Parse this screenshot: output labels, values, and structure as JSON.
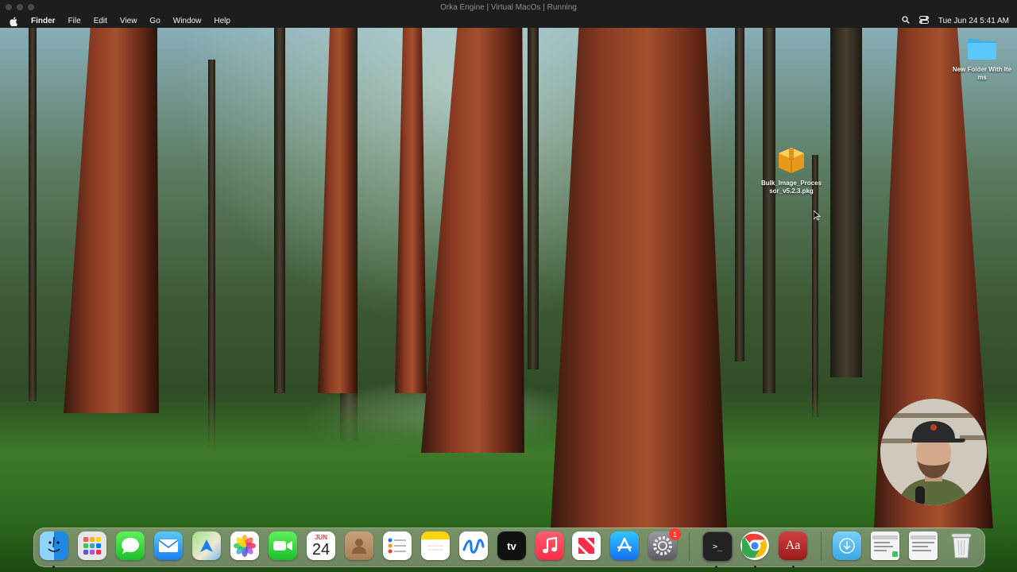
{
  "window": {
    "title": "Orka Engine | Virtual MacOs | Running"
  },
  "menubar": {
    "app": "Finder",
    "items": [
      "File",
      "Edit",
      "View",
      "Go",
      "Window",
      "Help"
    ],
    "clock": "Tue Jun 24  5:41 AM"
  },
  "desktop": {
    "icons": [
      {
        "label": "New Folder With Items",
        "icon": "folder-icon"
      },
      {
        "label": "Bulk_Image_Processor_v5.2.3.pkg",
        "icon": "package-icon"
      }
    ]
  },
  "dock": {
    "calendar_month": "JUN",
    "calendar_day": "24",
    "settings_badge": "1",
    "tv_label": "tv",
    "dictionary_label": "Aa",
    "terminal_label": ">_",
    "apps": [
      "Finder",
      "Launchpad",
      "Messages",
      "Mail",
      "Maps",
      "Photos",
      "FaceTime",
      "Calendar",
      "Contacts",
      "Reminders",
      "Notes",
      "Freeform",
      "TV",
      "Music",
      "News",
      "App Store",
      "System Settings",
      "Terminal",
      "Google Chrome",
      "Dictionary",
      "Downloads",
      "Recent Windows",
      "Trash"
    ]
  },
  "colors": {
    "menubar": "#1e1e20",
    "folder": "#5ac8fa",
    "package": "#f5b62d"
  }
}
